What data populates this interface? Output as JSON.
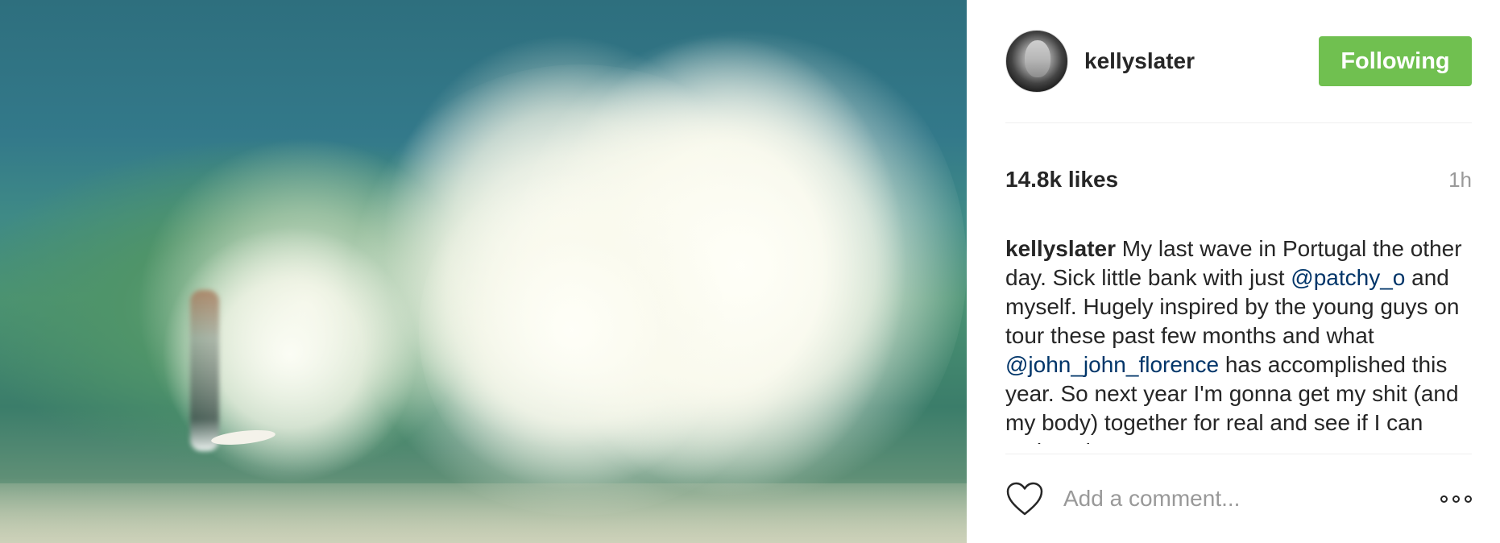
{
  "post": {
    "author": {
      "username": "kellyslater",
      "follow_label": "Following",
      "follow_color": "#70c050"
    },
    "photo": {
      "icon": "surf-photo"
    },
    "likes": "14.8k likes",
    "timestamp": "1h",
    "caption": {
      "author": "kellyslater",
      "parts": [
        " My last wave in Portugal the other day. Sick little bank with just ",
        "@patchy_o",
        " and myself. Hugely inspired by the young guys on tour these past few months and what ",
        "@john_john_florence",
        " has accomplished this year. So next year I'm gonna get my shit (and my body) together for real and see if I can make a last run at a"
      ]
    },
    "comment": {
      "placeholder": "Add a comment...",
      "like_icon": "heart-icon",
      "more_icon": "more-options-icon"
    },
    "colors": {
      "mention": "#003569",
      "text": "#262626",
      "muted": "#999999"
    }
  }
}
